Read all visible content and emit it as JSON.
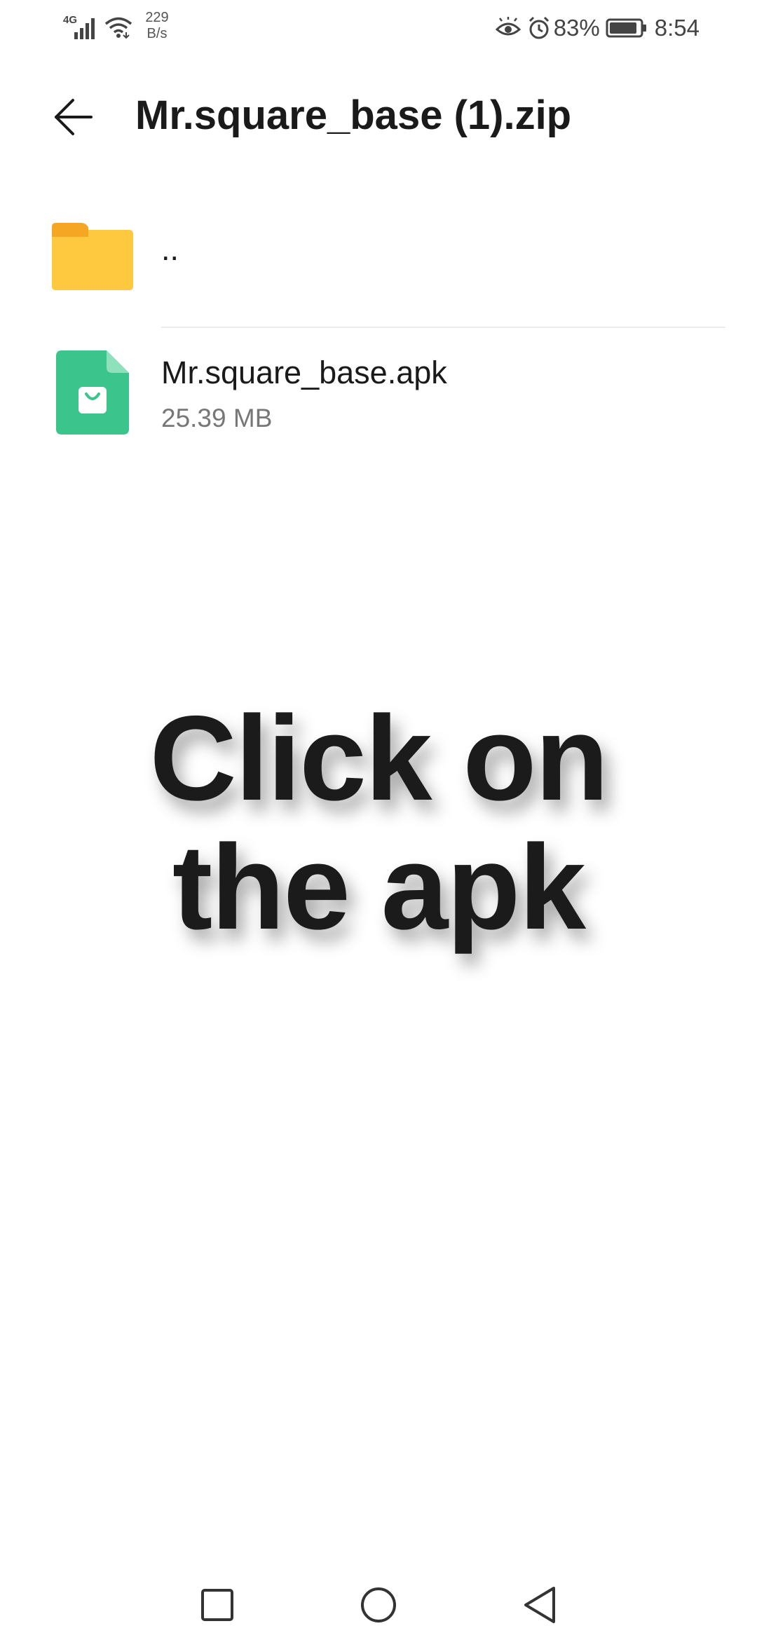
{
  "status_bar": {
    "network_type": "4G",
    "net_speed_value": "229",
    "net_speed_unit": "B/s",
    "battery_percent": "83%",
    "time": "8:54",
    "icons": [
      "signal-icon",
      "wifi-icon",
      "eye-comfort-icon",
      "alarm-icon",
      "battery-icon"
    ]
  },
  "app_bar": {
    "title": "Mr.square_base (1).zip",
    "back_icon": "arrow-left-icon"
  },
  "files": [
    {
      "name": "..",
      "icon": "folder-icon",
      "icon_color": "#FFC93F"
    },
    {
      "name": "Mr.square_base.apk",
      "size": "25.39 MB",
      "icon": "apk-icon",
      "icon_color": "#3CC48D"
    }
  ],
  "overlay": {
    "line1": "Click on",
    "line2": "the apk"
  },
  "nav_bar": {
    "icons": [
      "recent-apps-icon",
      "home-icon",
      "back-icon"
    ]
  }
}
